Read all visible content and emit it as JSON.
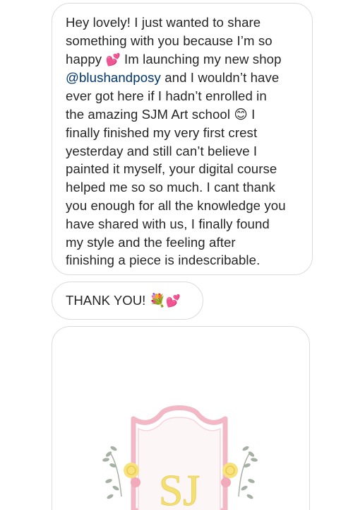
{
  "messages": [
    {
      "text_before": "Hey lovely! I just wanted to share\nsomething with you because I’m so\nhappy ",
      "emoji_1": "💕",
      "text_middle": "  Im launching my new shop\n",
      "mention": "@blushandposy",
      "text_after": " and I wouldn’t have\never got here if I hadn’t enrolled in\nthe amazing SJM Art school ",
      "emoji_2": "😊",
      "text_end": "  I\nfinally finished my very first crest\nyesterday and still can’t believe I\npainted it myself, your digital course\nhelped me so so much. I cant thank\nyou enough for all the knowledge you\nhave shared with us, I finally found\nmy style and the feeling after\nfinishing a piece is indescribable."
    },
    {
      "text": "THANK YOU! ",
      "emoji_1": "💐",
      "emoji_2": "💕"
    }
  ],
  "image_message": {
    "monogram": "SJ"
  },
  "colors": {
    "bubble_border": "#dbdbdb",
    "text": "#262626",
    "mention": "#003569",
    "crest_pink": "#f2b8c6",
    "monogram_yellow": "#f4df73",
    "leaf_grey": "#a7b0a4"
  }
}
